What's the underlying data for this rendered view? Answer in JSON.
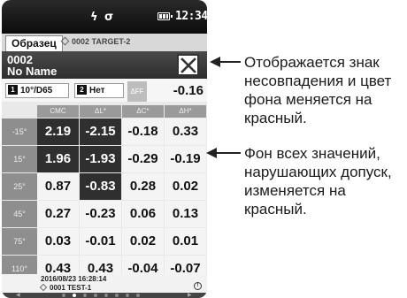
{
  "status": {
    "time": "12:34",
    "bolt_glyph": "ϟ",
    "link_glyph": "σ"
  },
  "tabs": {
    "sample": "Образец",
    "target": "0002 TARGET-2"
  },
  "sample": {
    "id": "0002",
    "name": "No Name"
  },
  "conditions": {
    "observer_num": "1",
    "observer": "10°/D65",
    "illum_num": "2",
    "illum": "Нет",
    "dff_label": "ΔFF",
    "dff_value": "-0.16"
  },
  "table": {
    "headers": [
      "CMC",
      "ΔL*",
      "ΔC*",
      "ΔH*"
    ],
    "rows": [
      {
        "label": "-15°",
        "cells": [
          {
            "v": "2.19",
            "fail": true
          },
          {
            "v": "-2.15",
            "fail": true
          },
          {
            "v": "-0.18",
            "fail": false
          },
          {
            "v": "0.33",
            "fail": false
          }
        ]
      },
      {
        "label": "15°",
        "cells": [
          {
            "v": "1.96",
            "fail": true
          },
          {
            "v": "-1.93",
            "fail": true
          },
          {
            "v": "-0.29",
            "fail": false
          },
          {
            "v": "-0.19",
            "fail": false
          }
        ]
      },
      {
        "label": "25°",
        "cells": [
          {
            "v": "0.87",
            "fail": false
          },
          {
            "v": "-0.83",
            "fail": true
          },
          {
            "v": "0.28",
            "fail": false
          },
          {
            "v": "0.02",
            "fail": false
          }
        ]
      },
      {
        "label": "45°",
        "cells": [
          {
            "v": "0.27",
            "fail": false
          },
          {
            "v": "-0.23",
            "fail": false
          },
          {
            "v": "0.06",
            "fail": false
          },
          {
            "v": "0.13",
            "fail": false
          }
        ]
      },
      {
        "label": "75°",
        "cells": [
          {
            "v": "0.03",
            "fail": false
          },
          {
            "v": "-0.01",
            "fail": false
          },
          {
            "v": "0.02",
            "fail": false
          },
          {
            "v": "0.01",
            "fail": false
          }
        ]
      },
      {
        "label": "110°",
        "cells": [
          {
            "v": "0.43",
            "fail": false
          },
          {
            "v": "0.43",
            "fail": false
          },
          {
            "v": "-0.04",
            "fail": false
          },
          {
            "v": "-0.07",
            "fail": false
          }
        ]
      }
    ]
  },
  "footer": {
    "datetime": "2016/08/23 16:28:14",
    "ref": "0001 TEST-1"
  },
  "callouts": {
    "mismatch": "Отображается знак несовпадения и цвет фона меняется на красный.",
    "tolerance": "Фон всех значений, нарушающих допуск, изменяется на красный."
  },
  "colors": {
    "fail_bg": "#2f2f2f",
    "pass_bg": "#f4f4f4"
  }
}
